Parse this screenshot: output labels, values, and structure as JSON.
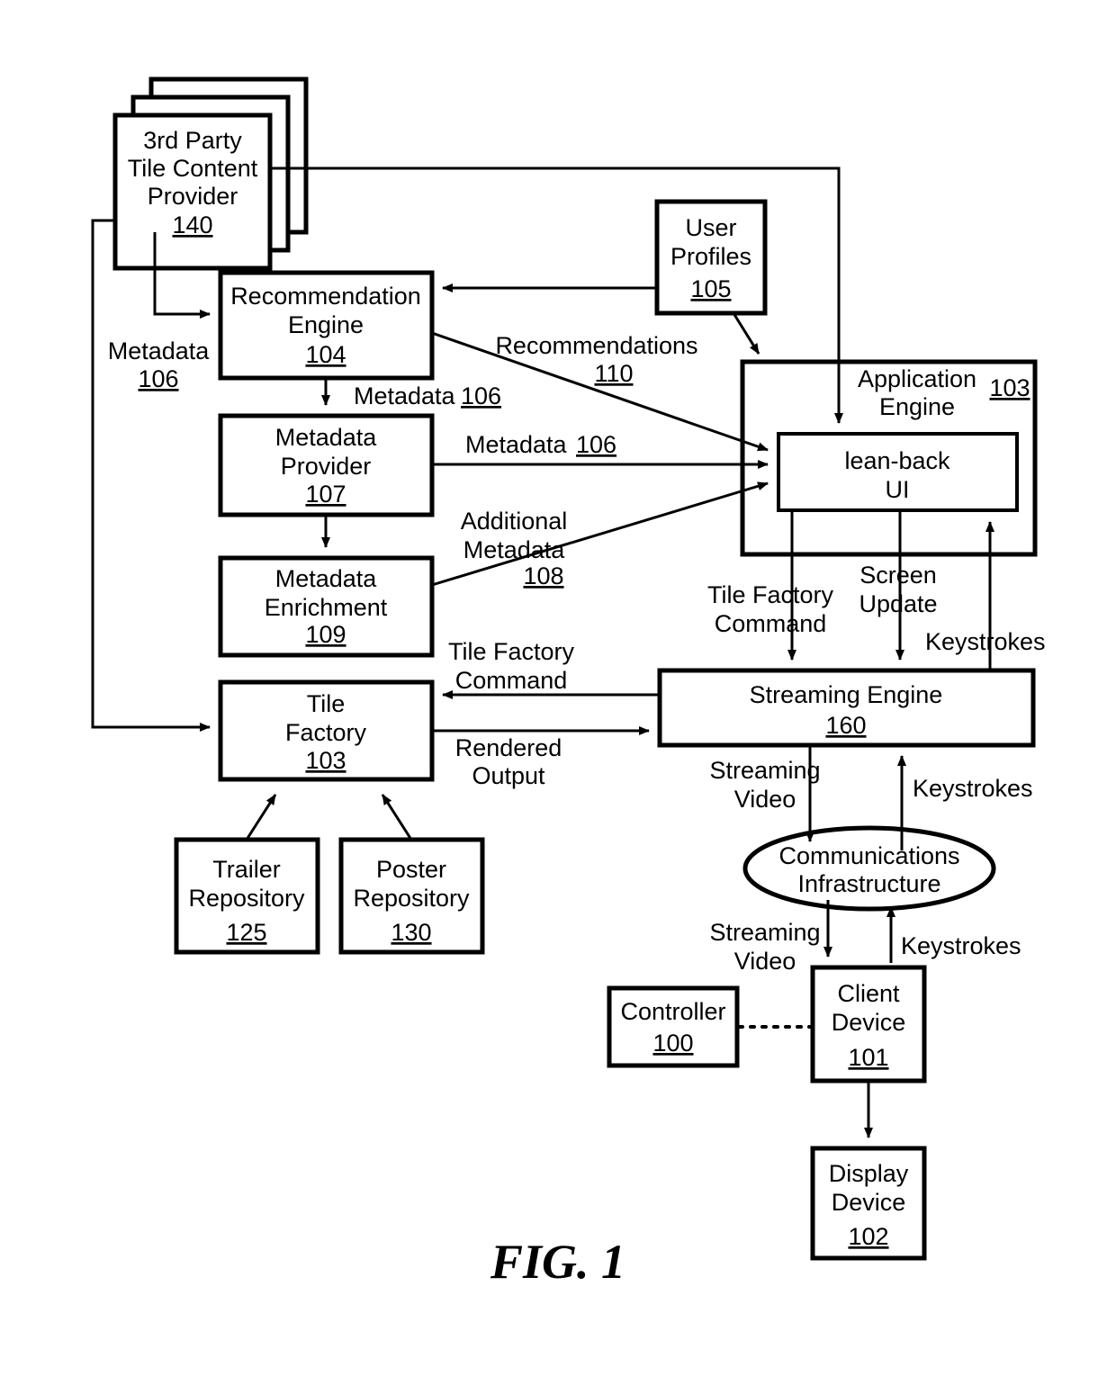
{
  "figure": {
    "caption": "FIG. 1",
    "colors": {
      "stroke": "#000000",
      "fill": "#ffffff"
    }
  },
  "nodes": {
    "third_party": {
      "line1": "3rd Party",
      "line2": "Tile Content",
      "line3": "Provider",
      "ref": "140"
    },
    "recommendation_engine": {
      "line1": "Recommendation",
      "line2": "Engine",
      "ref": "104"
    },
    "user_profiles": {
      "line1": "User",
      "line2": "Profiles",
      "ref": "105"
    },
    "application_engine": {
      "line1": "Application",
      "line2": "Engine",
      "ref": "103"
    },
    "lean_back_ui": {
      "line1": "lean-back",
      "line2": "UI"
    },
    "metadata_provider": {
      "line1": "Metadata",
      "line2": "Provider",
      "ref": "107"
    },
    "metadata_enrichment": {
      "line1": "Metadata",
      "line2": "Enrichment",
      "ref": "109"
    },
    "tile_factory": {
      "line1": "Tile",
      "line2": "Factory",
      "ref": "103"
    },
    "trailer_repository": {
      "line1": "Trailer",
      "line2": "Repository",
      "ref": "125"
    },
    "poster_repository": {
      "line1": "Poster",
      "line2": "Repository",
      "ref": "130"
    },
    "streaming_engine": {
      "line1": "Streaming Engine",
      "ref": "160"
    },
    "communications_infrastructure": {
      "line1": "Communications",
      "line2": "Infrastructure"
    },
    "controller": {
      "line1": "Controller",
      "ref": "100"
    },
    "client_device": {
      "line1": "Client",
      "line2": "Device",
      "ref": "101"
    },
    "display_device": {
      "line1": "Display",
      "line2": "Device",
      "ref": "102"
    }
  },
  "edge_labels": {
    "metadata_106_left": {
      "line1": "Metadata",
      "ref": "106"
    },
    "metadata_106_engine_to_provider": {
      "line1": "Metadata",
      "ref": "106"
    },
    "metadata_106_provider_to_ui": {
      "line1": "Metadata",
      "ref": "106"
    },
    "recommendations_110": {
      "line1": "Recommendations",
      "ref": "110"
    },
    "additional_metadata_108": {
      "line1": "Additional",
      "line2": "Metadata",
      "ref": "108"
    },
    "tile_factory_command_left": {
      "line1": "Tile Factory",
      "line2": "Command"
    },
    "rendered_output": {
      "line1": "Rendered",
      "line2": "Output"
    },
    "tile_factory_command_right": {
      "line1": "Tile Factory",
      "line2": "Command"
    },
    "screen_update": {
      "line1": "Screen",
      "line2": "Update"
    },
    "keystrokes_ui": {
      "line1": "Keystrokes"
    },
    "streaming_video_upper": {
      "line1": "Streaming",
      "line2": "Video"
    },
    "keystrokes_upper": {
      "line1": "Keystrokes"
    },
    "streaming_video_lower": {
      "line1": "Streaming",
      "line2": "Video"
    },
    "keystrokes_lower": {
      "line1": "Keystrokes"
    }
  }
}
